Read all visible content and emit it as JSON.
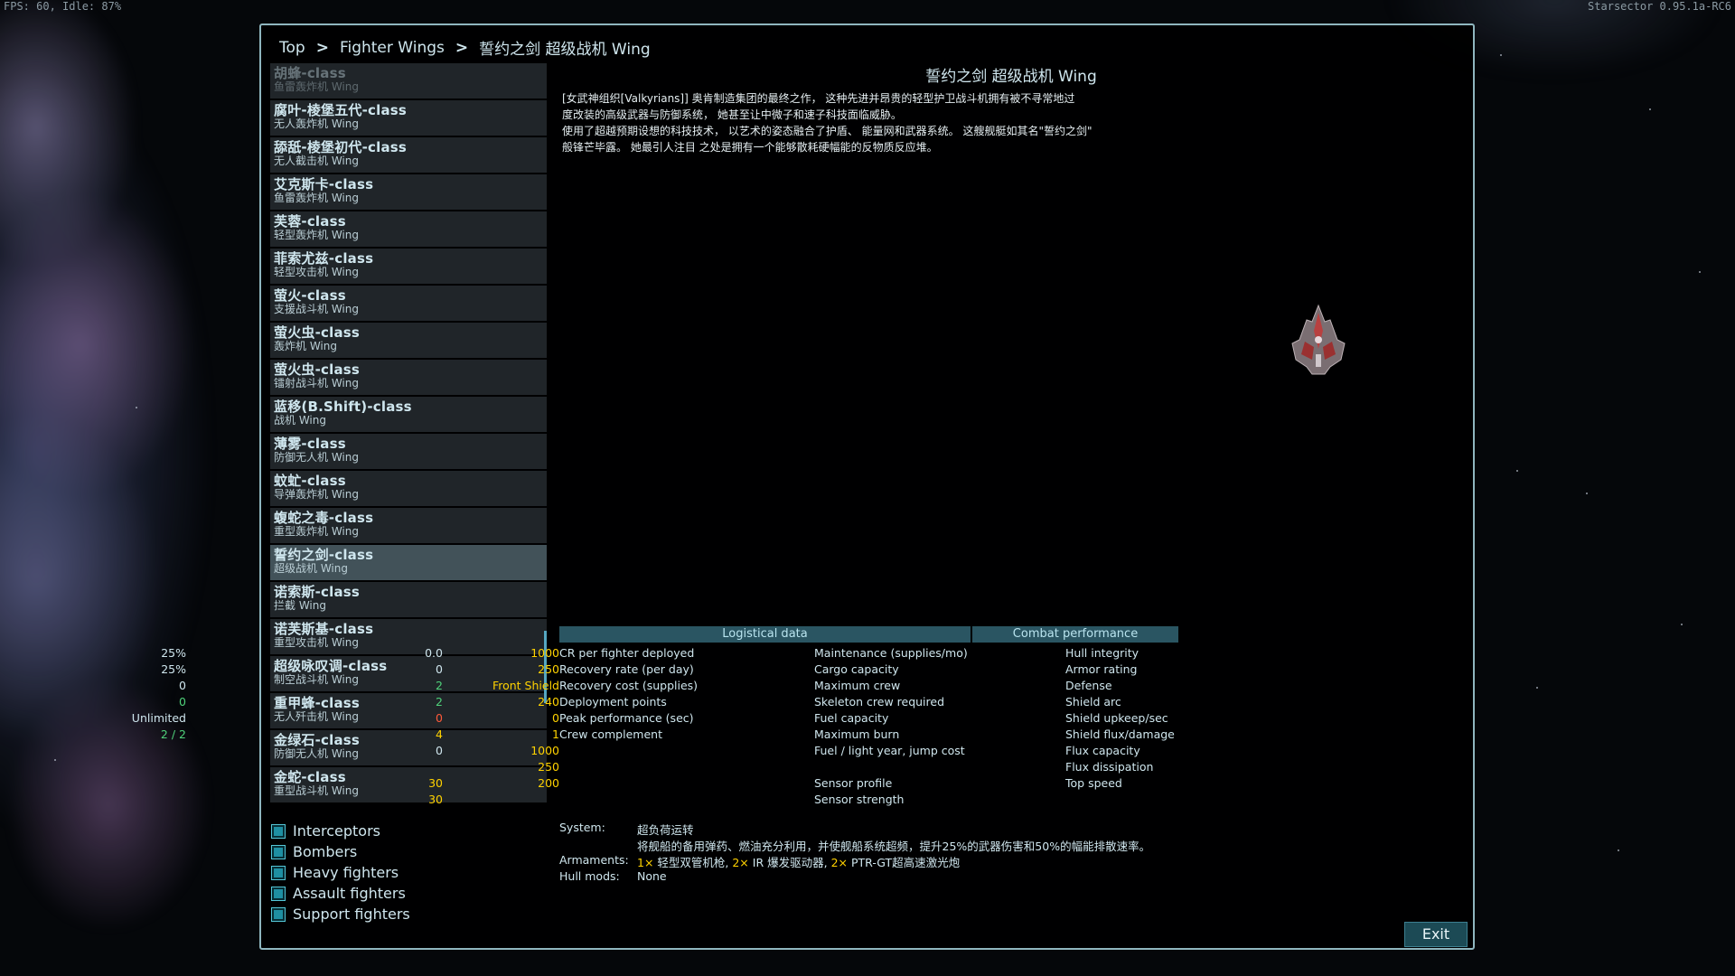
{
  "hud": {
    "fps": "FPS: 60, Idle: 87%",
    "version": "Starsector 0.95.1a-RC6"
  },
  "breadcrumb": [
    "Top",
    "Fighter Wings",
    "誓约之剑 超级战机 Wing"
  ],
  "breadcrumb_sep": ">",
  "wing_list": [
    {
      "name": "胡蜂-class",
      "sub": "鱼雷轰炸机 Wing"
    },
    {
      "name": "腐叶-棱堡五代-class",
      "sub": "无人轰炸机 Wing"
    },
    {
      "name": "舔舐-棱堡初代-class",
      "sub": "无人截击机 Wing"
    },
    {
      "name": "艾克斯卡-class",
      "sub": "鱼雷轰炸机 Wing"
    },
    {
      "name": "芙蓉-class",
      "sub": "轻型轰炸机 Wing"
    },
    {
      "name": "菲索尤兹-class",
      "sub": "轻型攻击机 Wing"
    },
    {
      "name": "萤火-class",
      "sub": "支援战斗机 Wing"
    },
    {
      "name": "萤火虫-class",
      "sub": "轰炸机 Wing"
    },
    {
      "name": "萤火虫-class",
      "sub": "镭射战斗机 Wing"
    },
    {
      "name": "蓝移(B.Shift)-class",
      "sub": "战机 Wing"
    },
    {
      "name": "薄雾-class",
      "sub": "防御无人机 Wing"
    },
    {
      "name": "蚊虻-class",
      "sub": "导弹轰炸机 Wing"
    },
    {
      "name": "蝮蛇之毒-class",
      "sub": "重型轰炸机 Wing"
    },
    {
      "name": "誓约之剑-class",
      "sub": "超级战机 Wing"
    },
    {
      "name": "诺索斯-class",
      "sub": "拦截 Wing"
    },
    {
      "name": "诺芙斯基-class",
      "sub": "重型攻击机 Wing"
    },
    {
      "name": "超级咏叹调-class",
      "sub": "制空战斗机 Wing"
    },
    {
      "name": "重甲蜂-class",
      "sub": "无人歼击机 Wing"
    },
    {
      "name": "金绿石-class",
      "sub": "防御无人机 Wing"
    },
    {
      "name": "金蛇-class",
      "sub": "重型战斗机 Wing"
    }
  ],
  "categories": [
    "Interceptors",
    "Bombers",
    "Heavy fighters",
    "Assault fighters",
    "Support fighters"
  ],
  "detail": {
    "title": "誓约之剑 超级战机 Wing",
    "description": [
      "[女武神组织[Valkyrians]] 奥肯制造集团的最终之作， 这种先进并昂贵的轻型护卫战斗机拥有被不寻常地过",
      "度改装的高级武器与防御系统， 她甚至让中微子和速子科技面临威胁。",
      "使用了超越预期设想的科技技术， 以艺术的姿态融合了护盾、 能量网和武器系统。 这艘舰艇如其名\"誓约之剑\"",
      "般锋芒毕露。 她最引人注目 之处是拥有一个能够散耗硬幅能的反物质反应堆。"
    ]
  },
  "logistical": {
    "header": "Logistical data",
    "rows": [
      {
        "label": "CR per fighter deployed",
        "value": "25%",
        "color": "white"
      },
      {
        "label": " Recovery rate (per day)",
        "value": "25%",
        "color": "white"
      },
      {
        "label": " Recovery cost (supplies)",
        "value": "0",
        "color": "white"
      },
      {
        "label": " Deployment points",
        "value": "0",
        "color": "green"
      },
      {
        "label": "Peak performance (sec)",
        "value": "Unlimited",
        "color": "white"
      },
      {
        "label": "Crew complement",
        "value": "2 / 2",
        "color": "green"
      }
    ],
    "rows2": [
      {
        "label": "Maintenance (supplies/mo)",
        "value": "0.0",
        "color": "white"
      },
      {
        "label": "Cargo capacity",
        "value": "0",
        "color": "white"
      },
      {
        "label": "Maximum crew",
        "value": "2",
        "color": "green"
      },
      {
        "label": "Skeleton crew required",
        "value": "2",
        "color": "green"
      },
      {
        "label": "Fuel capacity",
        "value": "0",
        "color": "red"
      },
      {
        "label": "Maximum burn",
        "value": "4",
        "color": "yellow"
      },
      {
        "label": "Fuel / light year, jump cost",
        "value": "0",
        "color": "white"
      },
      {
        "label": "",
        "value": "",
        "color": "white"
      },
      {
        "label": "Sensor profile",
        "value": "30",
        "color": "yellow"
      },
      {
        "label": "Sensor strength",
        "value": "30",
        "color": "yellow"
      }
    ]
  },
  "combat": {
    "header": "Combat performance",
    "rows": [
      {
        "label": "Hull integrity",
        "value": "1000",
        "color": "yellow"
      },
      {
        "label": "Armor rating",
        "value": "250",
        "color": "yellow"
      },
      {
        "label": "Defense",
        "value": "Front Shield",
        "color": "yellow"
      },
      {
        "label": "Shield arc",
        "value": "240",
        "color": "yellow"
      },
      {
        "label": "Shield upkeep/sec",
        "value": "0",
        "color": "yellow"
      },
      {
        "label": "Shield flux/damage",
        "value": "1",
        "color": "yellow"
      },
      {
        "label": "Flux capacity",
        "value": "1000",
        "color": "yellow"
      },
      {
        "label": "Flux dissipation",
        "value": "250",
        "color": "yellow"
      },
      {
        "label": "Top speed",
        "value": "200",
        "color": "yellow"
      }
    ]
  },
  "system": {
    "label": "System:",
    "name": "超负荷运转",
    "desc": "将舰船的备用弹药、燃油充分利用，并使舰船系统超频，提升25%的武器伤害和50%的幅能排散速率。"
  },
  "armaments": {
    "label": "Armaments:",
    "parts": [
      {
        "text": "1×",
        "color": "yellow"
      },
      {
        "text": " 轻型双管机枪, ",
        "color": "white"
      },
      {
        "text": "2×",
        "color": "yellow"
      },
      {
        "text": " IR 爆发驱动器, ",
        "color": "white"
      },
      {
        "text": "2×",
        "color": "yellow"
      },
      {
        "text": " PTR-GT超高速激光炮",
        "color": "white"
      }
    ]
  },
  "hullmods": {
    "label": "Hull mods:",
    "value": "None"
  },
  "exit_label": "Exit",
  "icons": {
    "category_checkbox": "checkbox-icon",
    "ship": "ship-sprite-icon"
  }
}
